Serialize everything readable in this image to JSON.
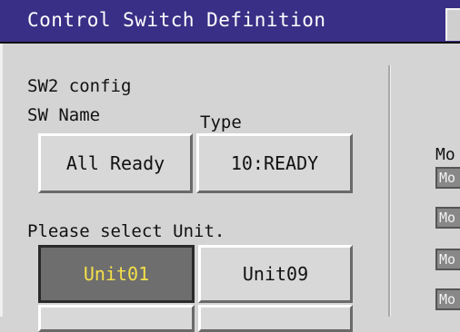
{
  "window": {
    "title": "Control Switch Definition"
  },
  "config": {
    "heading": "SW2 config",
    "sw_name_label": "SW Name",
    "type_label": "Type",
    "sw_name_value": "All Ready",
    "type_value": "10:READY"
  },
  "unit_select": {
    "prompt": "Please select Unit.",
    "units": [
      "Unit01",
      "Unit09"
    ],
    "selected": "Unit01"
  },
  "side": {
    "label": "Mo",
    "items": [
      "Mo",
      "Mo",
      "Mo",
      "Mo"
    ]
  },
  "colors": {
    "titlebar": "#3a2f86",
    "panel": "#d4d4d4",
    "selected_bg": "#6e6e6e",
    "selected_text": "#f4e04a"
  }
}
